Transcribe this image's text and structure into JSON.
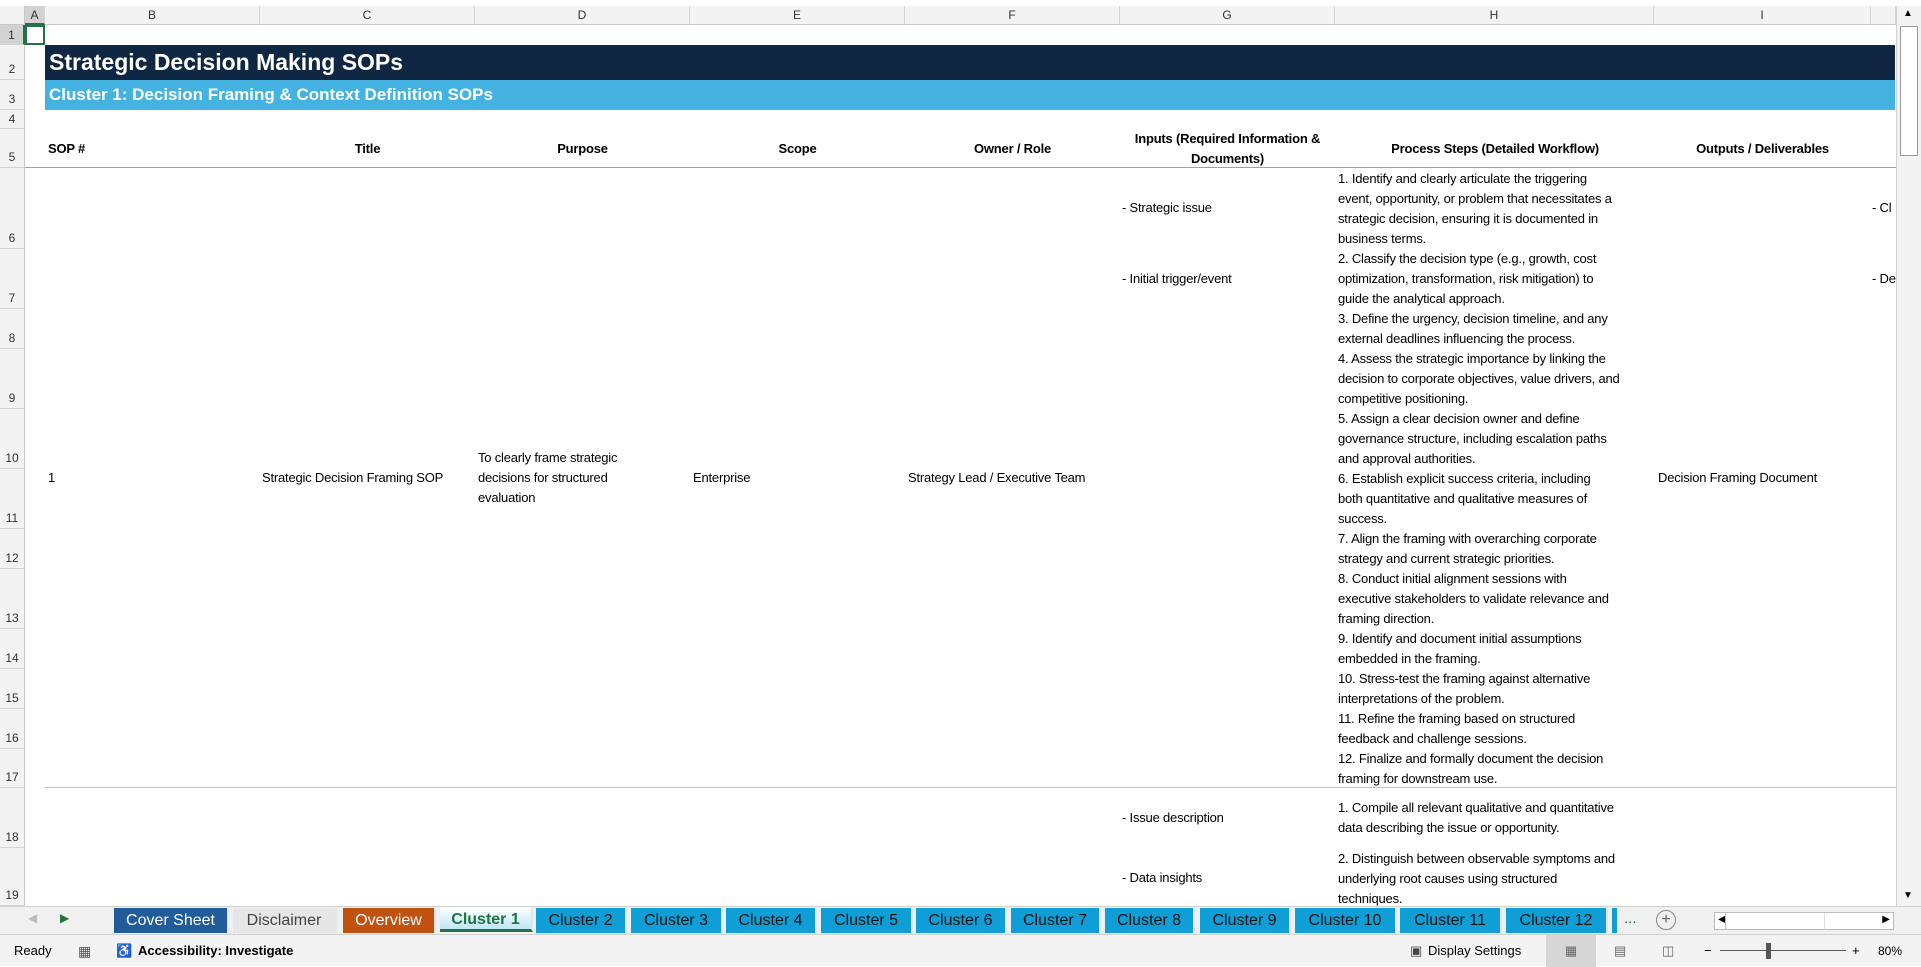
{
  "columns": [
    "A",
    "B",
    "C",
    "D",
    "E",
    "F",
    "G",
    "H",
    "I"
  ],
  "rows": [
    "1",
    "2",
    "3",
    "4",
    "5",
    "6",
    "7",
    "8",
    "9",
    "10",
    "11",
    "12",
    "13",
    "14",
    "15",
    "16",
    "17",
    "18",
    "19"
  ],
  "title": "Strategic Decision Making SOPs",
  "subtitle": "Cluster 1: Decision Framing & Context Definition SOPs",
  "headers": {
    "sop": "SOP #",
    "title": "Title",
    "purpose": "Purpose",
    "scope": "Scope",
    "owner": "Owner / Role",
    "inputs1": "Inputs (Required Information &",
    "inputs2": "Documents)",
    "steps": "Process Steps (Detailed Workflow)",
    "outputs": "Outputs / Deliverables"
  },
  "sop1": {
    "num": "1",
    "title": "Strategic Decision Framing SOP",
    "purpose": [
      "To clearly frame strategic",
      "decisions for structured",
      "evaluation"
    ],
    "scope": "Enterprise",
    "owner": "Strategy Lead / Executive Team",
    "inputs": [
      "- Strategic issue",
      "- Initial trigger/event"
    ],
    "outputs": "Decision Framing Document",
    "next_col": [
      "- Cl",
      "- De"
    ],
    "steps": [
      "1. Identify and clearly articulate the triggering",
      "event, opportunity, or problem that necessitates a",
      "strategic decision, ensuring it is documented in",
      "business terms.",
      "2. Classify the decision type (e.g., growth, cost",
      "optimization, transformation, risk mitigation) to",
      "guide the analytical approach.",
      "3. Define the urgency, decision timeline, and any",
      "external deadlines influencing the process.",
      "4. Assess the strategic importance by linking the",
      "decision to corporate objectives, value drivers, and",
      "competitive positioning.",
      "5. Assign a clear decision owner and define",
      "governance structure, including escalation paths",
      "and approval authorities.",
      "6. Establish explicit success criteria, including",
      "both quantitative and qualitative measures of",
      "success.",
      "7. Align the framing with overarching corporate",
      "strategy and current strategic priorities.",
      "8. Conduct initial alignment sessions with",
      "executive stakeholders to validate relevance and",
      "framing direction.",
      "9. Identify and document initial assumptions",
      "embedded in the framing.",
      "10. Stress-test the framing against alternative",
      "interpretations of the problem.",
      "11. Refine the framing based on structured",
      "feedback and challenge sessions.",
      "12. Finalize and formally document the decision",
      "framing for downstream use."
    ]
  },
  "sop2": {
    "inputs": [
      "- Issue description",
      "- Data insights"
    ],
    "steps": [
      "1. Compile all relevant qualitative and quantitative",
      "data describing the issue or opportunity.",
      "2. Distinguish between observable symptoms and",
      "underlying root causes using structured",
      "techniques."
    ]
  },
  "tabs": [
    "Cover Sheet",
    "Disclaimer",
    "Overview",
    "Cluster 1",
    "Cluster 2",
    "Cluster 3",
    "Cluster 4",
    "Cluster 5",
    "Cluster 6",
    "Cluster 7",
    "Cluster 8",
    "Cluster 9",
    "Cluster 10",
    "Cluster 11",
    "Cluster 12"
  ],
  "tabs_more": "...",
  "status": {
    "ready": "Ready",
    "accessibility": "Accessibility: Investigate",
    "display": "Display Settings",
    "zoom": "80%"
  },
  "colors": {
    "navy": "#0f2742",
    "lightblue": "#44b3e1",
    "tab": "#0f9ed5",
    "cover": "#1f5c99",
    "overview": "#c0510f",
    "active": "#217346"
  }
}
